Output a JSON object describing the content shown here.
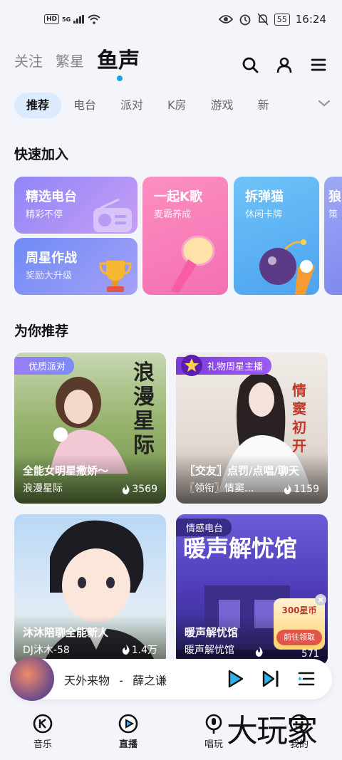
{
  "status_bar": {
    "badge": "HD",
    "signal": "5G",
    "battery": "55",
    "time": "16:24"
  },
  "top_tabs": [
    "关注",
    "繁星",
    "鱼声"
  ],
  "category_tabs": [
    "推荐",
    "电台",
    "派对",
    "K房",
    "游戏",
    "新"
  ],
  "sections": {
    "quick_join": "快速加入",
    "recommend": "为你推荐"
  },
  "quick_cards": [
    {
      "title": "精选电台",
      "subtitle": "精彩不停"
    },
    {
      "title": "周星作战",
      "subtitle": "奖励大升级"
    },
    {
      "title": "一起K歌",
      "subtitle": "麦霸养成"
    },
    {
      "title": "拆弹猫",
      "subtitle": "休闲卡牌"
    },
    {
      "title": "狼",
      "subtitle": "策"
    }
  ],
  "rec_cards": [
    {
      "badge": "优质派对",
      "title": "全能女明星撒娇～",
      "subtitle": "浪漫星际",
      "hot": "3569",
      "art": "浪漫星际"
    },
    {
      "badge": "礼物周星主播",
      "title": "〖交友〗点罚/点唱/聊天",
      "subtitle": "〖领衔〗情窦...",
      "hot": "1159",
      "art": "情窦初开"
    },
    {
      "badge": "",
      "title": "沐沐陪聊全能新人",
      "subtitle": "DJ沐木-58",
      "hot": "1.4万",
      "art": ""
    },
    {
      "badge": "情感电台",
      "title": "暖声解忧馆",
      "subtitle": "暖声解忧馆",
      "hot": "571",
      "art": "暖声解忧馆",
      "promo": "300星币",
      "promo_btn": "前往领取"
    }
  ],
  "player": {
    "song": "天外来物",
    "separator": "-",
    "artist": "薛之谦"
  },
  "bottom_nav": [
    "音乐",
    "直播",
    "唱玩",
    "我的"
  ],
  "watermark": "大玩家",
  "colors": {
    "accent": "#1aa3e8",
    "active_tab_bg": "#dceafd"
  }
}
